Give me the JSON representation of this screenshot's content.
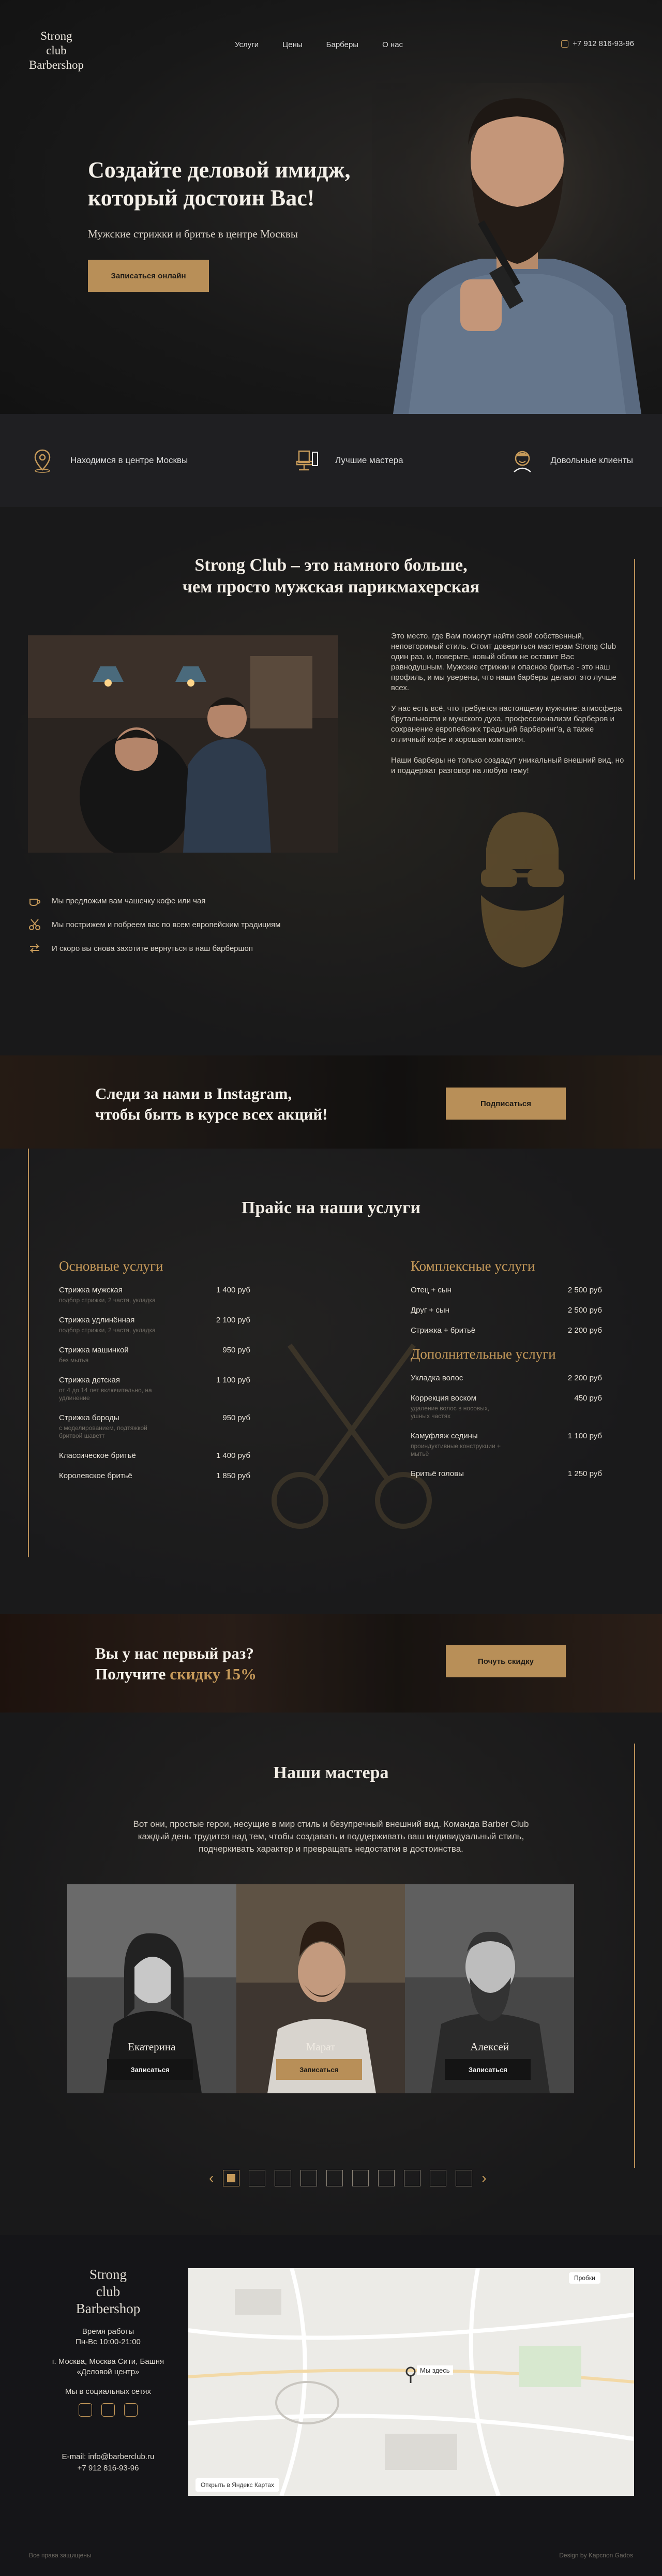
{
  "header": {
    "logo_line1": "Strong",
    "logo_line2": "club",
    "logo_line3": "Barbershop",
    "nav": [
      "Услуги",
      "Цены",
      "Барберы",
      "О нас"
    ],
    "phone": "+7 912 816-93-96"
  },
  "hero": {
    "title_line1": "Создайте деловой имидж,",
    "title_line2": "который достоин Вас!",
    "subtitle": "Мужские стрижки и бритье в центре Москвы",
    "cta": "Записаться онлайн"
  },
  "features": [
    {
      "icon": "map-pin-icon",
      "label": "Находимся в центре Москвы"
    },
    {
      "icon": "barber-chair-icon",
      "label": "Лучшие мастера"
    },
    {
      "icon": "happy-client-icon",
      "label": "Довольные клиенты"
    }
  ],
  "about": {
    "title_line1": "Strong Club – это намного больше,",
    "title_line2": "чем просто мужская парикмахерская",
    "p1": "Это место, где Вам помогут найти свой собственный, неповторимый стиль. Стоит довериться мастерам Strong Club один раз, и, поверьте, новый облик не оставит Вас равнодушным. Мужские стрижки и опасное бритье - это наш профиль, и мы уверены, что наши барберы делают это лучше всех.",
    "p2": "У нас есть всё, что требуется настоящему мужчине: атмосфера брутальности и мужского духа, профессионализм барберов и сохранение европейских традиций барберинг'а, а также отличный кофе и хорошая компания.",
    "p3": "Наши барберы не только создадут уникальный внешний вид, но и поддержат разговор на любую тему!",
    "list": [
      {
        "icon": "coffee-cup-icon",
        "text": "Мы предложим вам чашечку кофе или чая"
      },
      {
        "icon": "scissors-icon",
        "text": "Мы пострижем и побреем вас по всем европейским традициям"
      },
      {
        "icon": "return-arrows-icon",
        "text": "И скоро вы снова захотите вернуться в наш барбершоп"
      }
    ]
  },
  "instagram": {
    "title_line1": "Следи за нами в Instagram,",
    "title_line2": "чтобы быть в курсе всех акций!",
    "button": "Подписаться"
  },
  "prices": {
    "title": "Прайс на наши услуги",
    "basic": {
      "heading": "Основные услуги",
      "items": [
        {
          "name": "Стрижка мужская",
          "price": "1 400 руб",
          "note": "подбор стрижки, 2 частя, укладка"
        },
        {
          "name": "Стрижка удлинённая",
          "price": "2 100 руб",
          "note": "подбор стрижки, 2 частя, укладка"
        },
        {
          "name": "Стрижка машинкой",
          "price": "950 руб",
          "note": "без мытья"
        },
        {
          "name": "Стрижка детская",
          "price": "1 100 руб",
          "note": "от 4 до 14 лет включительно, на удлинение"
        },
        {
          "name": "Стрижка бороды",
          "price": "950 руб",
          "note": "с моделированием, подтяжкой бритвой шаветт"
        },
        {
          "name": "Классическое бритьё",
          "price": "1 400 руб",
          "note": ""
        },
        {
          "name": "Королевское бритьё",
          "price": "1 850 руб",
          "note": ""
        }
      ]
    },
    "complex": {
      "heading": "Комплексные услуги",
      "items": [
        {
          "name": "Отец + сын",
          "price": "2 500 руб",
          "note": ""
        },
        {
          "name": "Друг + сын",
          "price": "2 500 руб",
          "note": ""
        },
        {
          "name": "Стрижка + бритьё",
          "price": "2 200 руб",
          "note": ""
        }
      ]
    },
    "extra": {
      "heading": "Дополнительные услуги",
      "items": [
        {
          "name": "Укладка волос",
          "price": "2 200 руб",
          "note": ""
        },
        {
          "name": "Коррекция воском",
          "price": "450 руб",
          "note": "удаление волос в носовых, ушных частях"
        },
        {
          "name": "Камуфляж седины",
          "price": "1 100 руб",
          "note": "проиндуктивные конструкции + мытьё"
        },
        {
          "name": "Бритьё головы",
          "price": "1 250 руб",
          "note": ""
        }
      ]
    }
  },
  "discount": {
    "title_line1": "Вы у нас первый раз?",
    "title_prefix": "Получите ",
    "title_accent": "скидку 15%",
    "button": "Почуть скидку"
  },
  "masters": {
    "title": "Наши мастера",
    "text": "Вот они, простые герои, несущие в мир стиль и безупречный внешний вид. Команда Barber Club каждый день трудится над тем, чтобы создавать и поддерживать ваш индивидуальный стиль, подчеркивать характер и превращать недостатки в достоинства.",
    "cards": [
      {
        "name": "Екатерина",
        "button": "Записаться",
        "highlight": false
      },
      {
        "name": "Марат",
        "button": "Записаться",
        "highlight": true
      },
      {
        "name": "Алексей",
        "button": "Записаться",
        "highlight": false
      }
    ],
    "pages": 10,
    "active_page": 1
  },
  "footer": {
    "logo_line1": "Strong",
    "logo_line2": "club",
    "logo_line3": "Barbershop",
    "hours_label": "Время работы",
    "hours": "Пн-Вс 10:00-21:00",
    "address": "г. Москва, Москва Сити, Башня «Деловой центр»",
    "socials_label": "Мы в социальных сетях",
    "email": "E-mail: info@barberclub.ru",
    "phone": "+7 912 816-93-96",
    "copyright": "Все права защищены",
    "design": "Design by Kapcnon Gados",
    "map": {
      "label": "Мы здесь",
      "open_label": "Открыть в Яндекс Картах",
      "traffic_label": "Пробки"
    }
  },
  "colors": {
    "accent": "#b88f58",
    "background": "#1c1c1e"
  }
}
